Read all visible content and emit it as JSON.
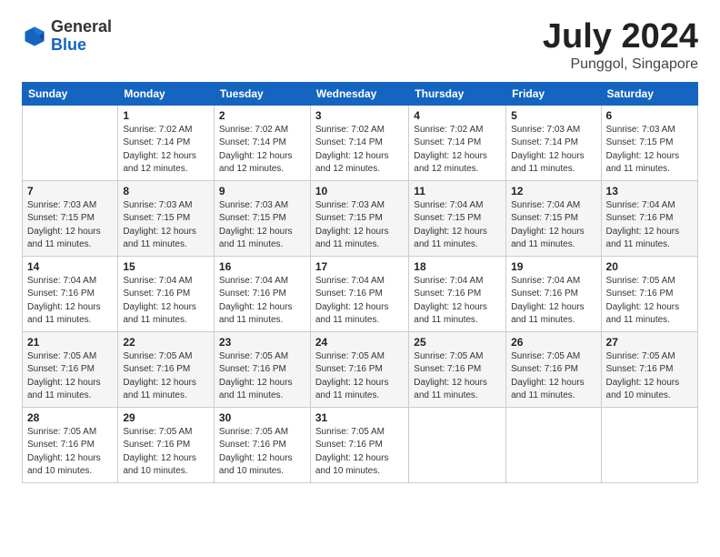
{
  "header": {
    "logo_general": "General",
    "logo_blue": "Blue",
    "title": "July 2024",
    "subtitle": "Punggol, Singapore"
  },
  "calendar": {
    "days_of_week": [
      "Sunday",
      "Monday",
      "Tuesday",
      "Wednesday",
      "Thursday",
      "Friday",
      "Saturday"
    ],
    "weeks": [
      [
        {
          "day": "",
          "info": ""
        },
        {
          "day": "1",
          "info": "Sunrise: 7:02 AM\nSunset: 7:14 PM\nDaylight: 12 hours\nand 12 minutes."
        },
        {
          "day": "2",
          "info": "Sunrise: 7:02 AM\nSunset: 7:14 PM\nDaylight: 12 hours\nand 12 minutes."
        },
        {
          "day": "3",
          "info": "Sunrise: 7:02 AM\nSunset: 7:14 PM\nDaylight: 12 hours\nand 12 minutes."
        },
        {
          "day": "4",
          "info": "Sunrise: 7:02 AM\nSunset: 7:14 PM\nDaylight: 12 hours\nand 12 minutes."
        },
        {
          "day": "5",
          "info": "Sunrise: 7:03 AM\nSunset: 7:14 PM\nDaylight: 12 hours\nand 11 minutes."
        },
        {
          "day": "6",
          "info": "Sunrise: 7:03 AM\nSunset: 7:15 PM\nDaylight: 12 hours\nand 11 minutes."
        }
      ],
      [
        {
          "day": "7",
          "info": "Sunrise: 7:03 AM\nSunset: 7:15 PM\nDaylight: 12 hours\nand 11 minutes."
        },
        {
          "day": "8",
          "info": "Sunrise: 7:03 AM\nSunset: 7:15 PM\nDaylight: 12 hours\nand 11 minutes."
        },
        {
          "day": "9",
          "info": "Sunrise: 7:03 AM\nSunset: 7:15 PM\nDaylight: 12 hours\nand 11 minutes."
        },
        {
          "day": "10",
          "info": "Sunrise: 7:03 AM\nSunset: 7:15 PM\nDaylight: 12 hours\nand 11 minutes."
        },
        {
          "day": "11",
          "info": "Sunrise: 7:04 AM\nSunset: 7:15 PM\nDaylight: 12 hours\nand 11 minutes."
        },
        {
          "day": "12",
          "info": "Sunrise: 7:04 AM\nSunset: 7:15 PM\nDaylight: 12 hours\nand 11 minutes."
        },
        {
          "day": "13",
          "info": "Sunrise: 7:04 AM\nSunset: 7:16 PM\nDaylight: 12 hours\nand 11 minutes."
        }
      ],
      [
        {
          "day": "14",
          "info": "Sunrise: 7:04 AM\nSunset: 7:16 PM\nDaylight: 12 hours\nand 11 minutes."
        },
        {
          "day": "15",
          "info": "Sunrise: 7:04 AM\nSunset: 7:16 PM\nDaylight: 12 hours\nand 11 minutes."
        },
        {
          "day": "16",
          "info": "Sunrise: 7:04 AM\nSunset: 7:16 PM\nDaylight: 12 hours\nand 11 minutes."
        },
        {
          "day": "17",
          "info": "Sunrise: 7:04 AM\nSunset: 7:16 PM\nDaylight: 12 hours\nand 11 minutes."
        },
        {
          "day": "18",
          "info": "Sunrise: 7:04 AM\nSunset: 7:16 PM\nDaylight: 12 hours\nand 11 minutes."
        },
        {
          "day": "19",
          "info": "Sunrise: 7:04 AM\nSunset: 7:16 PM\nDaylight: 12 hours\nand 11 minutes."
        },
        {
          "day": "20",
          "info": "Sunrise: 7:05 AM\nSunset: 7:16 PM\nDaylight: 12 hours\nand 11 minutes."
        }
      ],
      [
        {
          "day": "21",
          "info": "Sunrise: 7:05 AM\nSunset: 7:16 PM\nDaylight: 12 hours\nand 11 minutes."
        },
        {
          "day": "22",
          "info": "Sunrise: 7:05 AM\nSunset: 7:16 PM\nDaylight: 12 hours\nand 11 minutes."
        },
        {
          "day": "23",
          "info": "Sunrise: 7:05 AM\nSunset: 7:16 PM\nDaylight: 12 hours\nand 11 minutes."
        },
        {
          "day": "24",
          "info": "Sunrise: 7:05 AM\nSunset: 7:16 PM\nDaylight: 12 hours\nand 11 minutes."
        },
        {
          "day": "25",
          "info": "Sunrise: 7:05 AM\nSunset: 7:16 PM\nDaylight: 12 hours\nand 11 minutes."
        },
        {
          "day": "26",
          "info": "Sunrise: 7:05 AM\nSunset: 7:16 PM\nDaylight: 12 hours\nand 11 minutes."
        },
        {
          "day": "27",
          "info": "Sunrise: 7:05 AM\nSunset: 7:16 PM\nDaylight: 12 hours\nand 10 minutes."
        }
      ],
      [
        {
          "day": "28",
          "info": "Sunrise: 7:05 AM\nSunset: 7:16 PM\nDaylight: 12 hours\nand 10 minutes."
        },
        {
          "day": "29",
          "info": "Sunrise: 7:05 AM\nSunset: 7:16 PM\nDaylight: 12 hours\nand 10 minutes."
        },
        {
          "day": "30",
          "info": "Sunrise: 7:05 AM\nSunset: 7:16 PM\nDaylight: 12 hours\nand 10 minutes."
        },
        {
          "day": "31",
          "info": "Sunrise: 7:05 AM\nSunset: 7:16 PM\nDaylight: 12 hours\nand 10 minutes."
        },
        {
          "day": "",
          "info": ""
        },
        {
          "day": "",
          "info": ""
        },
        {
          "day": "",
          "info": ""
        }
      ]
    ]
  }
}
